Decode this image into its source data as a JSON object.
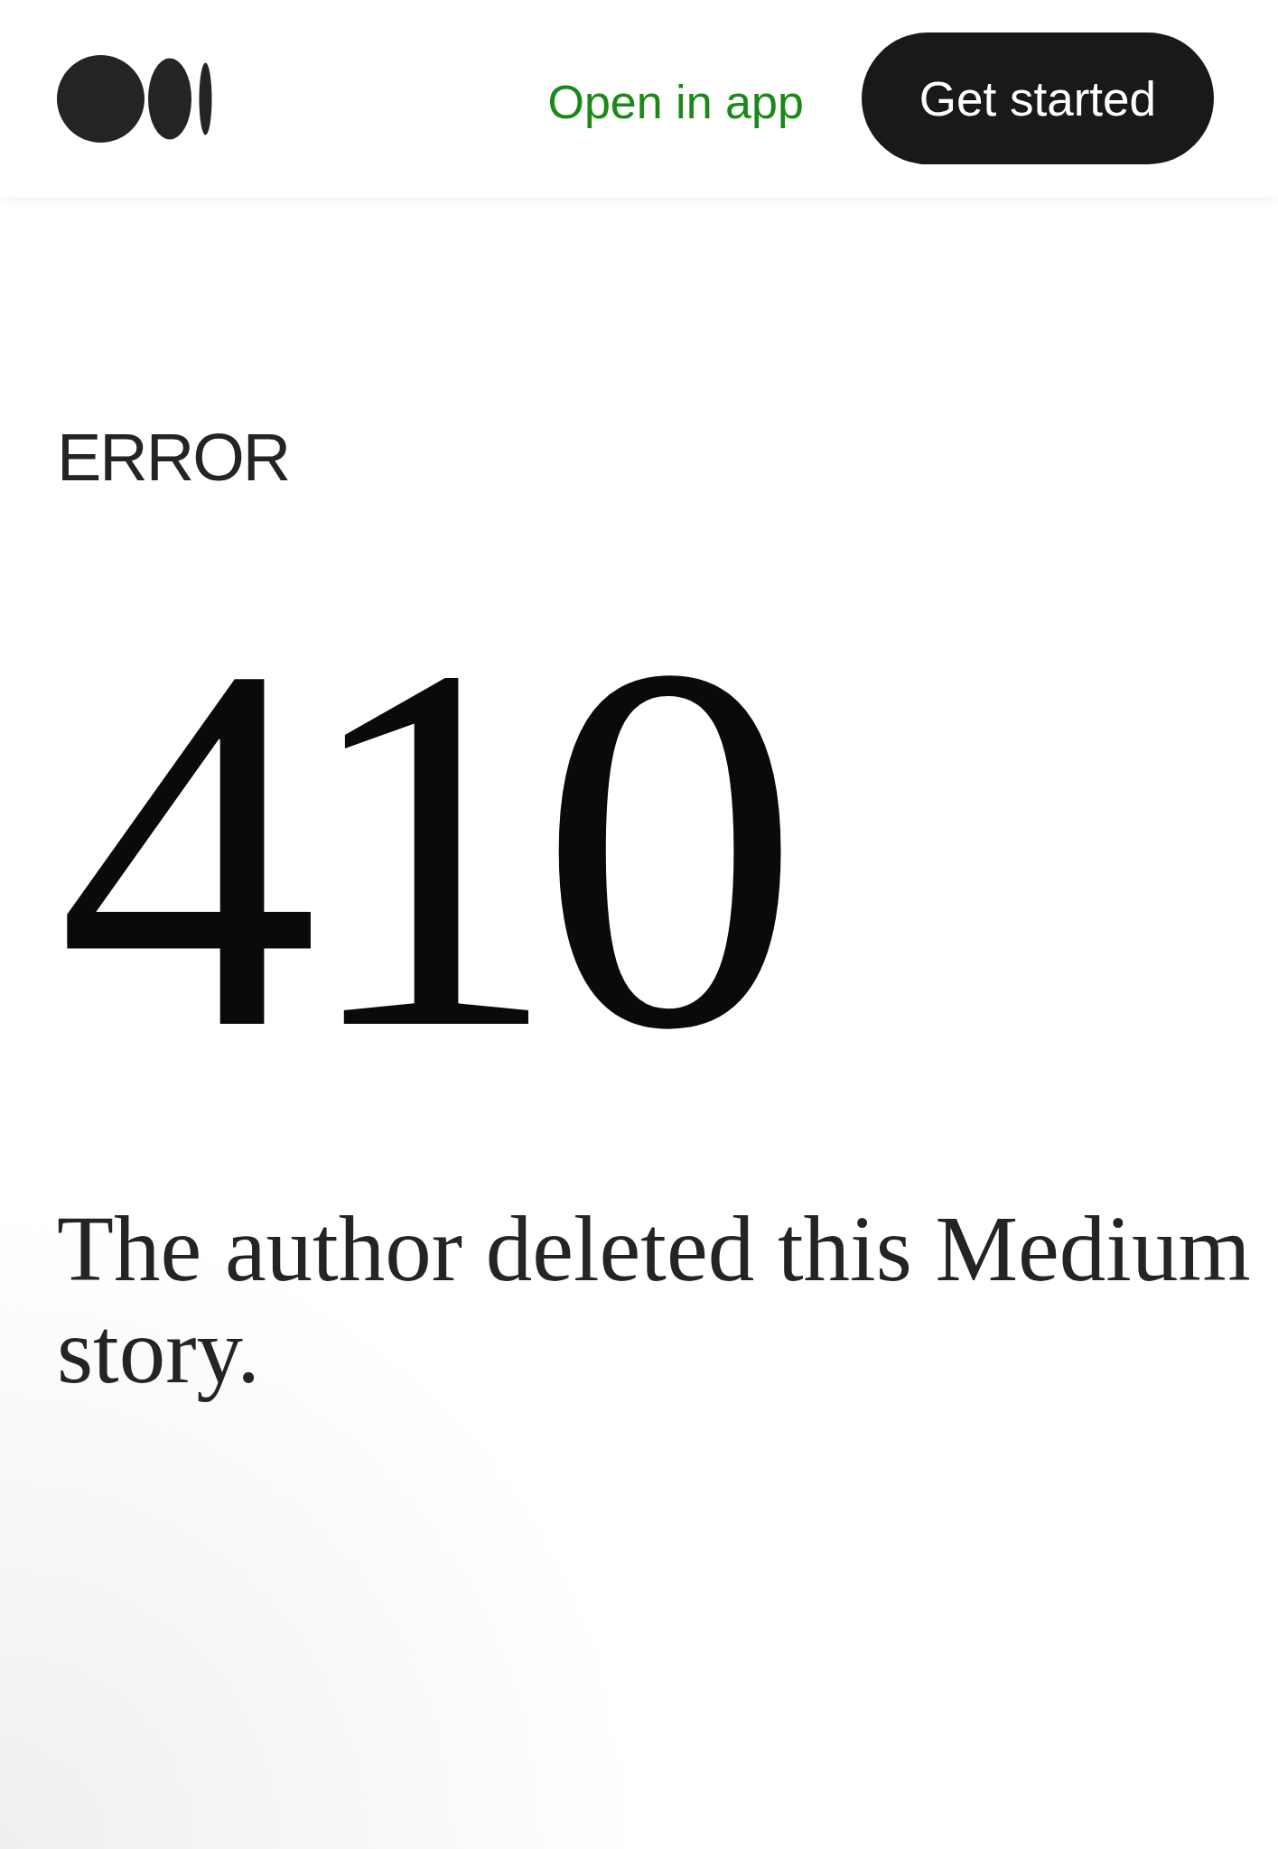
{
  "header": {
    "link": "Open in app",
    "button": "Get started"
  },
  "error": {
    "label": "ERROR",
    "code": "410",
    "message": "The author deleted this Medium story."
  }
}
